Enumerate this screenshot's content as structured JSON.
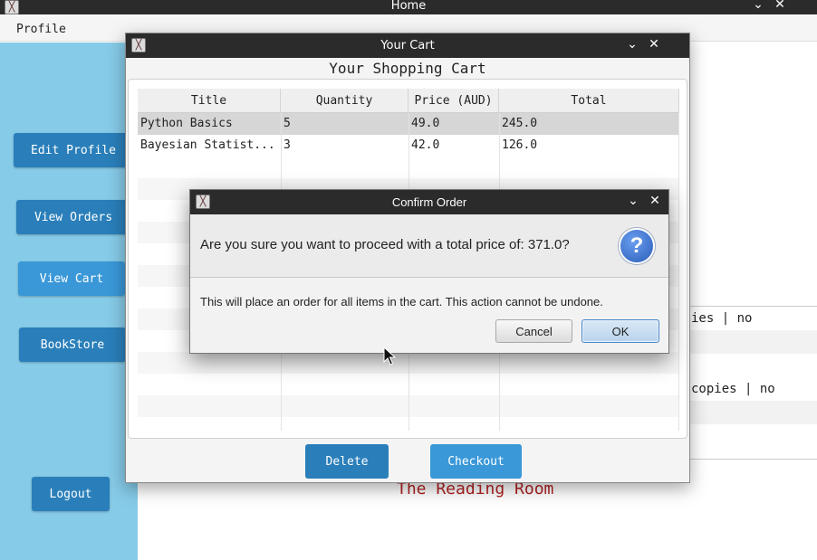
{
  "main_window": {
    "title": "Home",
    "menu": {
      "profile": "Profile"
    },
    "sidebar": {
      "edit_profile": "Edit Profile",
      "view_orders": "View Orders",
      "view_cart": "View Cart",
      "bookstore": "BookStore",
      "logout": "Logout"
    },
    "background_rows": [
      "ies | no",
      "",
      "",
      "copies | no",
      "",
      ""
    ],
    "footer_text": "The Reading Room"
  },
  "cart_window": {
    "title": "Your Cart",
    "heading": "Your Shopping Cart",
    "columns": [
      "Title",
      "Quantity",
      "Price (AUD)",
      "Total"
    ],
    "rows": [
      {
        "title": "Python Basics",
        "quantity": "5",
        "price": "49.0",
        "total": "245.0"
      },
      {
        "title": "Bayesian Statist...",
        "quantity": "3",
        "price": "42.0",
        "total": "126.0"
      }
    ],
    "buttons": {
      "delete": "Delete",
      "checkout": "Checkout"
    }
  },
  "confirm_dialog": {
    "title": "Confirm Order",
    "question": "Are you sure you want to proceed with a total price of: 371.0?",
    "icon_glyph": "?",
    "content": "This will place an order for all items in the cart. This action cannot be undone.",
    "cancel": "Cancel",
    "ok": "OK"
  },
  "colors": {
    "sidebar_bg": "#86cbe8",
    "button_blue": "#2a7fba",
    "titlebar": "#2b2b2b",
    "footer_red": "#b22222"
  },
  "icons": [
    "app-icon",
    "minimize-icon",
    "close-icon",
    "question-icon",
    "mouse-cursor-icon"
  ]
}
